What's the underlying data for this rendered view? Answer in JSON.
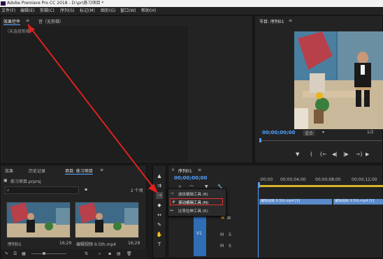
{
  "window": {
    "title": "Adobe Premiere Pro CC 2018 - D:\\pr\\练习项目 *"
  },
  "menu": [
    "文件(F)",
    "编辑(E)",
    "剪辑(C)",
    "序列(S)",
    "标记(M)",
    "图形(G)",
    "窗口(W)",
    "帮助(H)"
  ],
  "effects_panel": {
    "tab_active": "效果控件",
    "tab_other": "音（无剪辑）",
    "placeholder": "（未选择剪辑）"
  },
  "program_monitor": {
    "tab": "节目: 序列01",
    "timecode": "00;00;00;00",
    "fit_label": "适合",
    "scale_label": "1/2"
  },
  "project_panel": {
    "tabs": [
      "效果",
      "历史记录",
      "项目: 练习项目"
    ],
    "file": "练习项目.prproj",
    "count": "2 个项",
    "items": [
      {
        "name": "序列01",
        "duration": "16;29"
      },
      {
        "name": "编辑视频 9.5th.mp4",
        "duration": "16;29"
      }
    ]
  },
  "timeline": {
    "tab": "序列01",
    "timecode": "00;00;00;00",
    "ruler": [
      ":00;00",
      "00;00;04;00",
      "00;00;08;00",
      "00;00;12;00"
    ],
    "track_label": "V1",
    "clips": [
      "编辑视频 9.5th.mp4 [V]",
      "编辑视频 9.5th.mp4 [V]"
    ]
  },
  "tool_menu": {
    "items": [
      {
        "label": "波纹编辑工具 (B)",
        "highlighted": false
      },
      {
        "label": "滚动编辑工具 (N)",
        "highlighted": true
      },
      {
        "label": "比率拉伸工具 (R)",
        "highlighted": false
      }
    ]
  },
  "colors": {
    "accent": "#4fa0ff",
    "highlight_box": "#e53030",
    "arrow": "#e02020"
  }
}
